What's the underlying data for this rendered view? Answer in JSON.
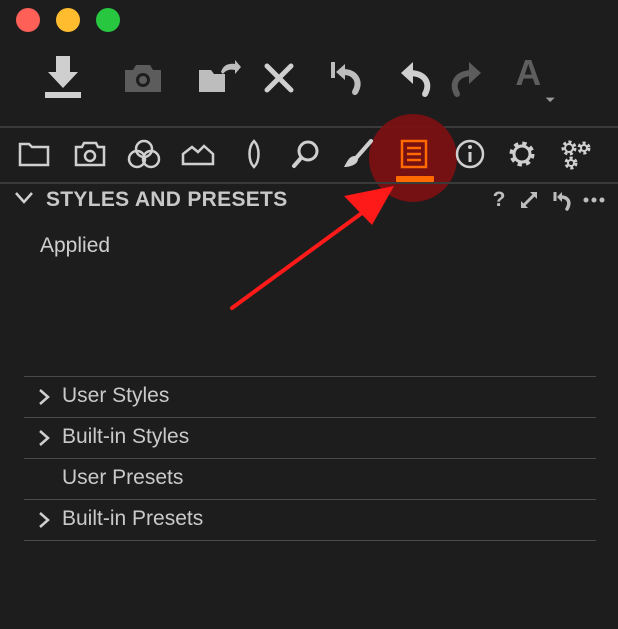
{
  "window": {
    "traffic_lights": [
      {
        "name": "close",
        "color": "#fe5f57"
      },
      {
        "name": "minimize",
        "color": "#febc2e"
      },
      {
        "name": "zoom",
        "color": "#27c840"
      }
    ]
  },
  "toolbar": {
    "buttons": [
      {
        "id": "import",
        "icon": "import-icon",
        "enabled": true
      },
      {
        "id": "capture",
        "icon": "camera-icon",
        "enabled": false
      },
      {
        "id": "export",
        "icon": "export-icon",
        "enabled": true
      },
      {
        "id": "delete",
        "icon": "x-icon",
        "enabled": true
      },
      {
        "id": "reset",
        "icon": "reset-icon",
        "enabled": true
      },
      {
        "id": "undo",
        "icon": "undo-icon",
        "enabled": true
      },
      {
        "id": "redo",
        "icon": "redo-icon",
        "enabled": false
      },
      {
        "id": "auto-adjust",
        "icon": "auto-adjust-icon",
        "label": "A",
        "enabled": false
      }
    ]
  },
  "tabs": {
    "items": [
      {
        "id": "library",
        "icon": "folder-icon"
      },
      {
        "id": "capture",
        "icon": "camera-icon"
      },
      {
        "id": "color",
        "icon": "color-circles-icon"
      },
      {
        "id": "exposure",
        "icon": "exposure-icon"
      },
      {
        "id": "lens",
        "icon": "lens-icon"
      },
      {
        "id": "details",
        "icon": "magnifier-icon"
      },
      {
        "id": "adjustments",
        "icon": "brush-icon"
      },
      {
        "id": "metadata",
        "icon": "list-icon",
        "active": true
      },
      {
        "id": "info",
        "icon": "info-icon"
      },
      {
        "id": "settings",
        "icon": "gear-icon"
      },
      {
        "id": "batch",
        "icon": "gears-icon"
      }
    ],
    "active_color": "#ff6a00",
    "highlight_color": "#7d0f12"
  },
  "panel": {
    "title": "STYLES AND PRESETS",
    "help_label": "?",
    "applied_label": "Applied",
    "list": [
      {
        "label": "User Styles",
        "expandable": true
      },
      {
        "label": "Built-in Styles",
        "expandable": true
      },
      {
        "label": "User Presets",
        "expandable": false
      },
      {
        "label": "Built-in Presets",
        "expandable": true
      }
    ]
  },
  "annotation": {
    "arrow_color": "#ff1a1a"
  }
}
